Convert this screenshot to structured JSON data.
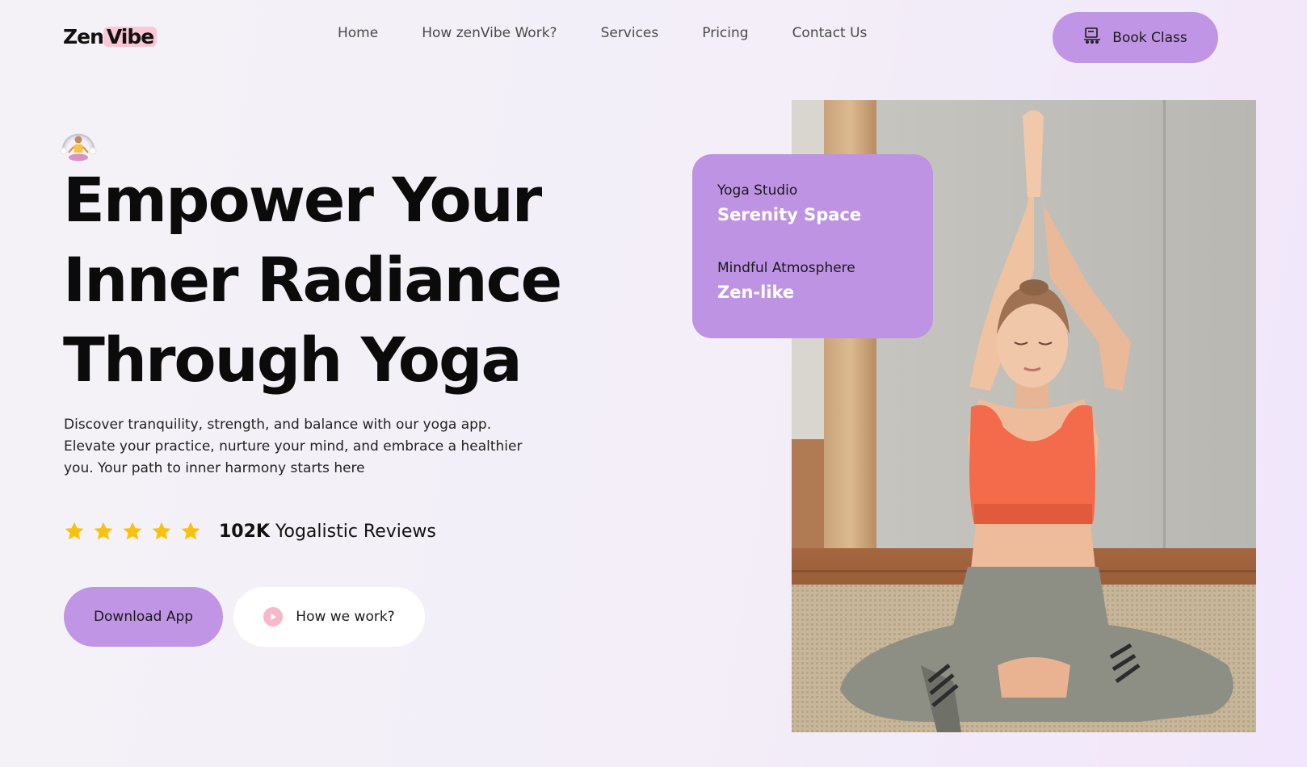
{
  "brand": {
    "name_part1": "Zen",
    "name_part2": "Vibe"
  },
  "nav": {
    "items": [
      {
        "label": "Home"
      },
      {
        "label": "How zenVibe Work?"
      },
      {
        "label": "Services"
      },
      {
        "label": "Pricing"
      },
      {
        "label": "Contact Us"
      }
    ]
  },
  "header": {
    "book_label": "Book Class",
    "book_icon": "laptop-calendar-icon"
  },
  "hero": {
    "headline_lines": [
      "Empower Your",
      "Inner Radiance",
      "Through Yoga"
    ],
    "description": "Discover tranquility, strength, and balance with our yoga app. Elevate your practice, nurture your mind, and embrace a healthier you. Your path to inner harmony starts here",
    "rating": {
      "stars": 5,
      "count": "102K",
      "label": "Yogalistic Reviews"
    },
    "download_label": "Download App",
    "how_label": "How we work?"
  },
  "info_card": {
    "items": [
      {
        "label": "Yoga Studio",
        "value": "Serenity Space"
      },
      {
        "label": "Mindful Atmosphere",
        "value": "Zen-like"
      }
    ]
  },
  "colors": {
    "accent": "#c195e5",
    "star": "#f7c10d",
    "logo_highlight": "#f9c7d6",
    "play": "#f7b8cb"
  }
}
